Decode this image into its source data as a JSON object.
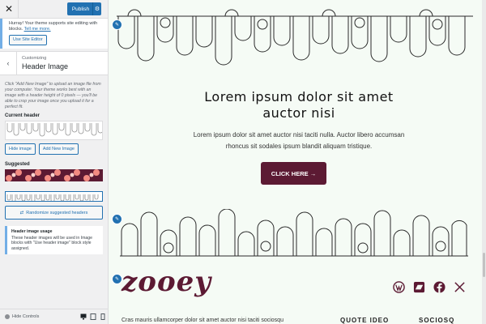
{
  "topbar": {
    "close_icon": "close-icon",
    "publish_label": "Publish"
  },
  "notice": {
    "text": "Hurray! Your theme supports site editing with blocks.",
    "link": "Tell me more.",
    "button": "Use Site Editor"
  },
  "section": {
    "sub": "Customizing",
    "title": "Header Image"
  },
  "panel": {
    "help": "Click \"Add New Image\" to upload an image file from your computer. Your theme works best with an image with a header height of 0 pixels — you'll be able to crop your image once you upload it for a perfect fit.",
    "current_label": "Current header",
    "hide_image": "Hide image",
    "add_new_image": "Add New Image",
    "suggested_label": "Suggested",
    "randomize": "Randomize suggested headers",
    "usage_title": "Header image usage",
    "usage_text": "These header images will be used in Image blocks with \"Use header image\" block style assigned."
  },
  "footer": {
    "hide_controls": "Hide Controls",
    "devices": [
      "desktop-icon",
      "tablet-icon",
      "mobile-icon"
    ]
  },
  "preview": {
    "heading_line1": "Lorem ipsum dolor sit amet",
    "heading_line2": "auctor nisi",
    "description": "Lorem ipsum dolor sit amet auctor nisi taciti nulla. Auctor libero accumsan rhoncus sit sodales ipsum blandit aliquam tristique.",
    "cta": "CLICK HERE →",
    "logo": "zooey",
    "socials": [
      "wordpress-icon",
      "bandcamp-icon",
      "facebook-icon",
      "x-icon"
    ],
    "bottom_text": "Cras mauris ullamcorper dolor sit amet auctor nisi taciti sociosqu",
    "bottom_heading_1": "QUOTE IDEO",
    "bottom_heading_2": "SOCIOSQ"
  },
  "colors": {
    "accent": "#2271b1",
    "brand": "#5c1a33",
    "preview_bg": "#f5fbf5"
  }
}
